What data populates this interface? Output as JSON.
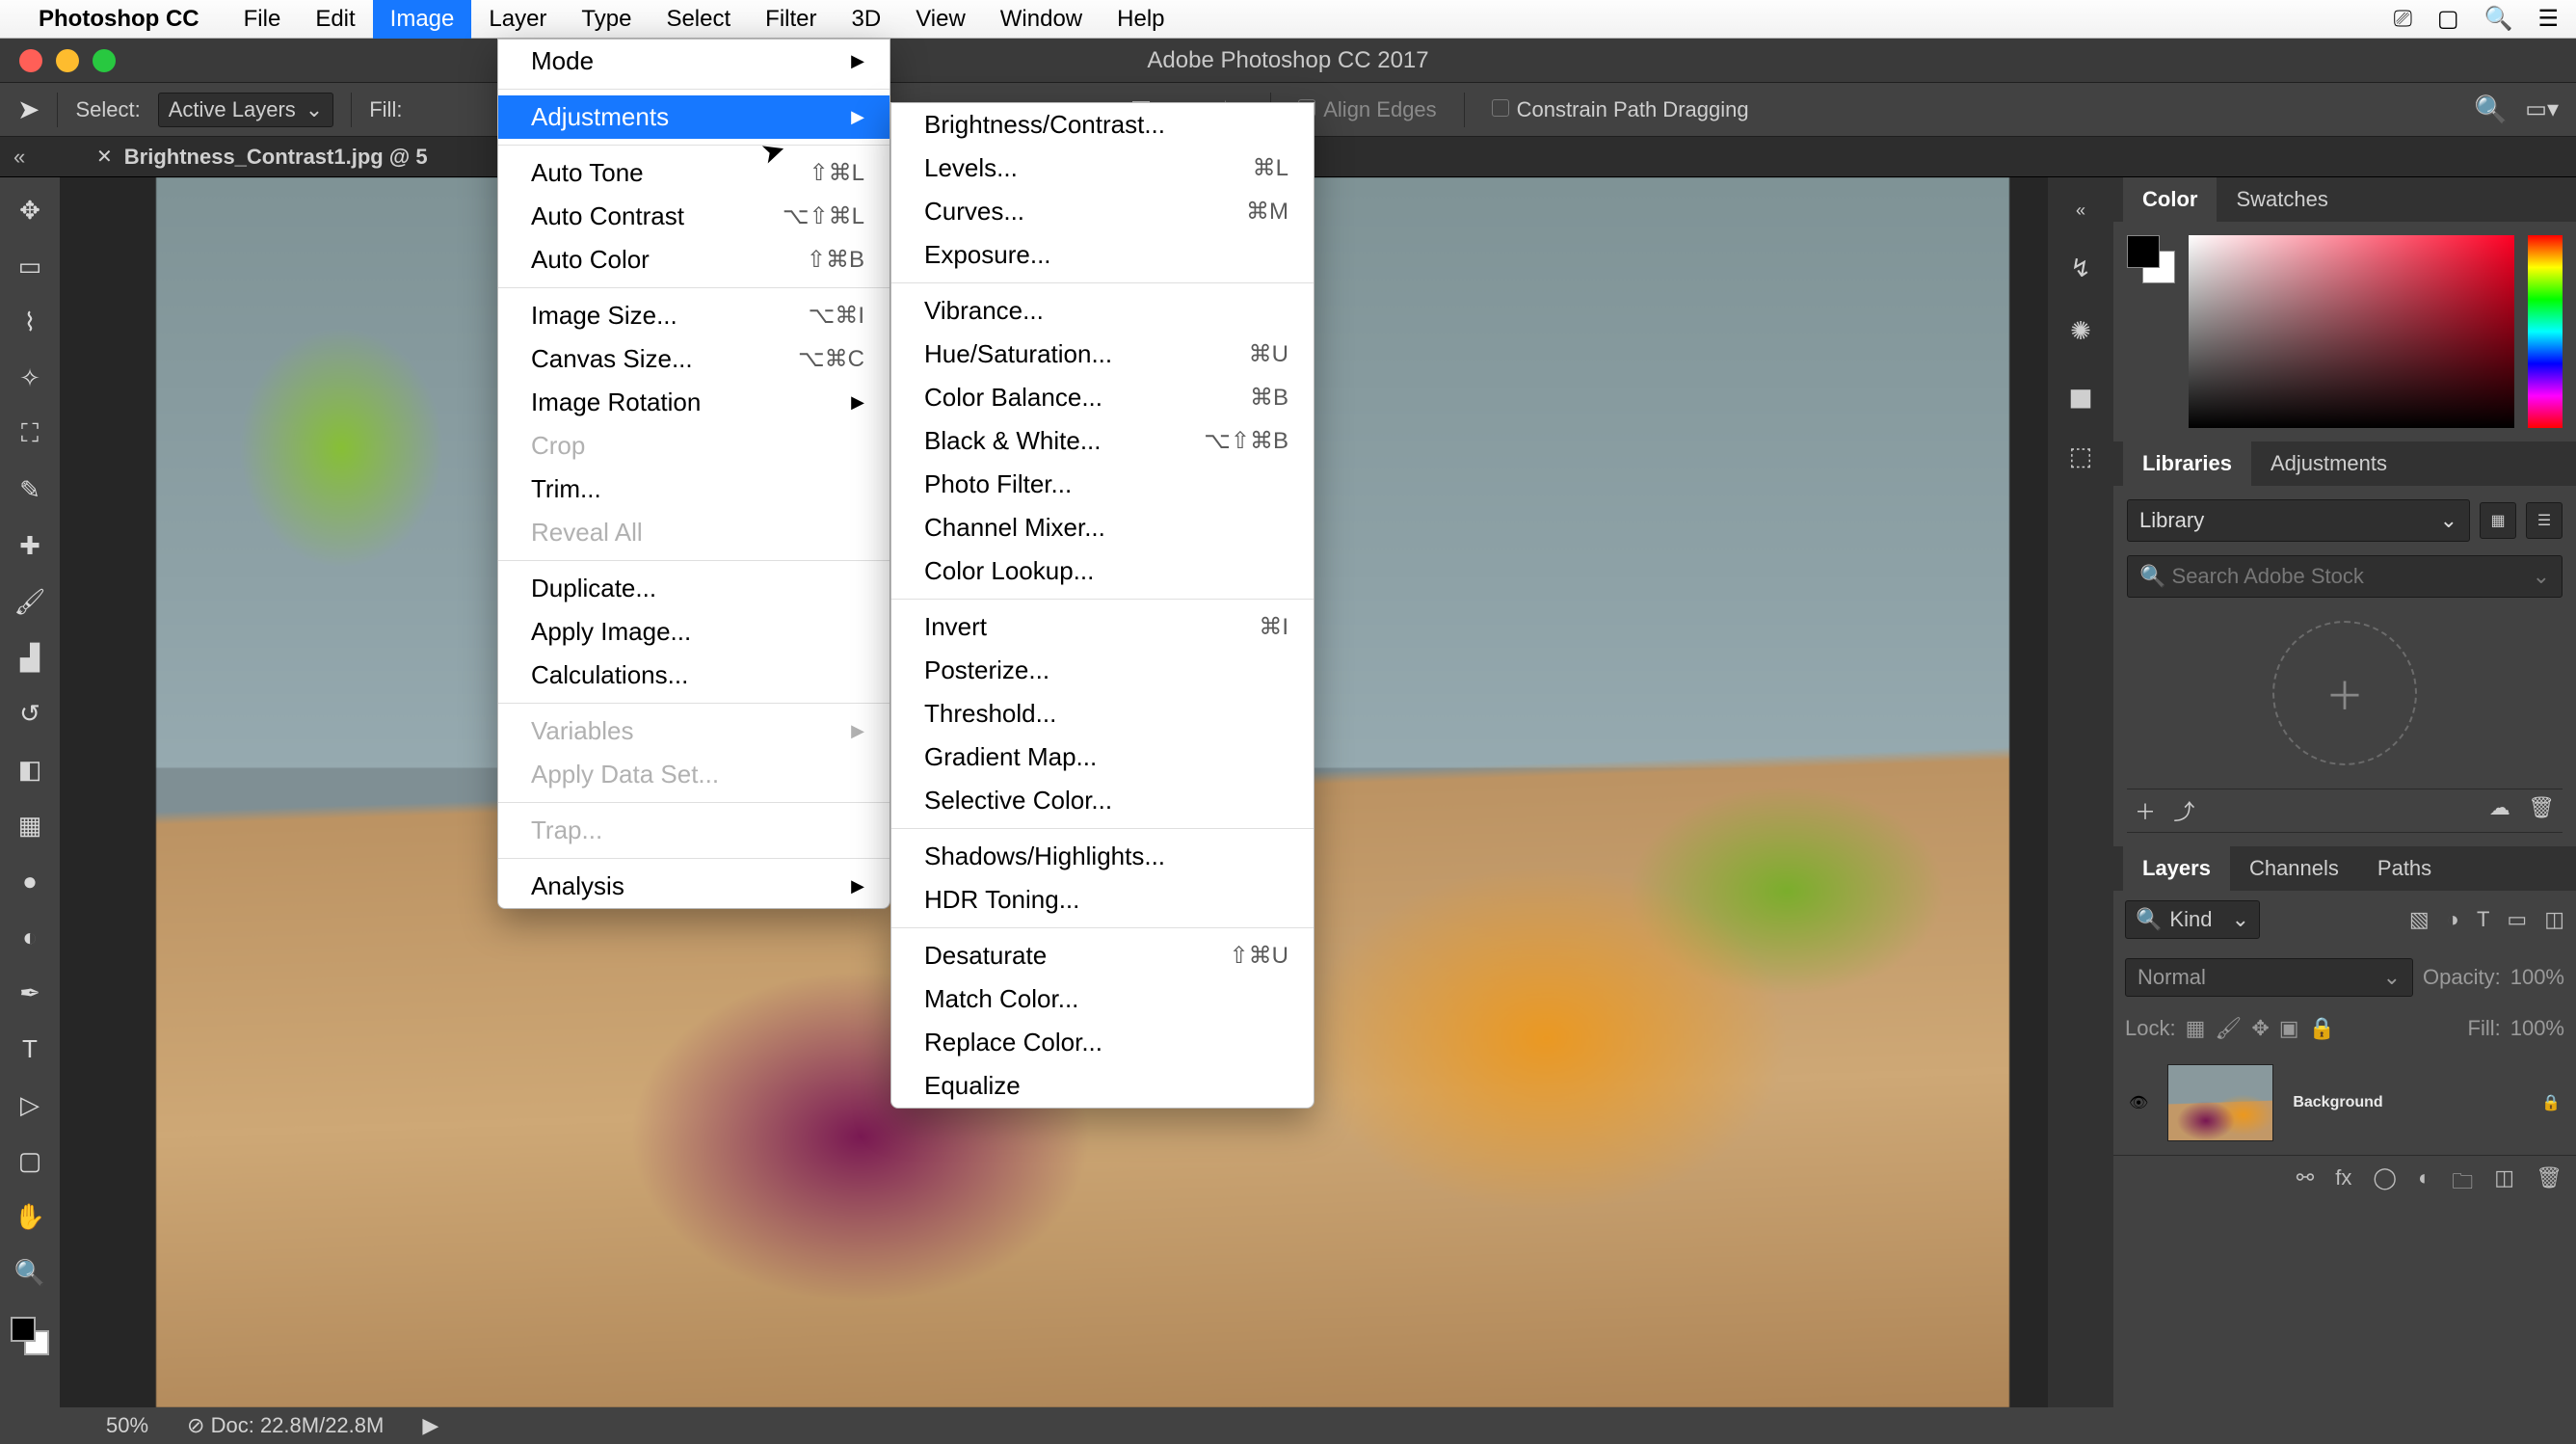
{
  "menubar": {
    "app_name": "Photoshop CC",
    "menus": [
      "File",
      "Edit",
      "Image",
      "Layer",
      "Type",
      "Select",
      "Filter",
      "3D",
      "View",
      "Window",
      "Help"
    ],
    "active": "Image"
  },
  "window": {
    "title": "Adobe Photoshop CC 2017"
  },
  "options_bar": {
    "select_label": "Select:",
    "select_value": "Active Layers",
    "fill_label": "Fill:",
    "align_edges": "Align Edges",
    "constrain": "Constrain Path Dragging"
  },
  "tab": {
    "filename": "Brightness_Contrast1.jpg @ 5"
  },
  "status": {
    "zoom": "50%",
    "doc": "Doc: 22.8M/22.8M"
  },
  "image_menu": {
    "groups": [
      [
        {
          "label": "Mode",
          "submenu": true
        }
      ],
      [
        {
          "label": "Adjustments",
          "submenu": true,
          "active": true
        }
      ],
      [
        {
          "label": "Auto Tone",
          "shortcut": "⇧⌘L"
        },
        {
          "label": "Auto Contrast",
          "shortcut": "⌥⇧⌘L"
        },
        {
          "label": "Auto Color",
          "shortcut": "⇧⌘B"
        }
      ],
      [
        {
          "label": "Image Size...",
          "shortcut": "⌥⌘I"
        },
        {
          "label": "Canvas Size...",
          "shortcut": "⌥⌘C"
        },
        {
          "label": "Image Rotation",
          "submenu": true
        },
        {
          "label": "Crop",
          "disabled": true
        },
        {
          "label": "Trim..."
        },
        {
          "label": "Reveal All",
          "disabled": true
        }
      ],
      [
        {
          "label": "Duplicate..."
        },
        {
          "label": "Apply Image..."
        },
        {
          "label": "Calculations..."
        }
      ],
      [
        {
          "label": "Variables",
          "submenu": true,
          "disabled": true
        },
        {
          "label": "Apply Data Set...",
          "disabled": true
        }
      ],
      [
        {
          "label": "Trap...",
          "disabled": true
        }
      ],
      [
        {
          "label": "Analysis",
          "submenu": true
        }
      ]
    ]
  },
  "adjustments_menu": {
    "groups": [
      [
        {
          "label": "Brightness/Contrast..."
        },
        {
          "label": "Levels...",
          "shortcut": "⌘L"
        },
        {
          "label": "Curves...",
          "shortcut": "⌘M"
        },
        {
          "label": "Exposure..."
        }
      ],
      [
        {
          "label": "Vibrance..."
        },
        {
          "label": "Hue/Saturation...",
          "shortcut": "⌘U"
        },
        {
          "label": "Color Balance...",
          "shortcut": "⌘B"
        },
        {
          "label": "Black & White...",
          "shortcut": "⌥⇧⌘B"
        },
        {
          "label": "Photo Filter..."
        },
        {
          "label": "Channel Mixer..."
        },
        {
          "label": "Color Lookup..."
        }
      ],
      [
        {
          "label": "Invert",
          "shortcut": "⌘I"
        },
        {
          "label": "Posterize..."
        },
        {
          "label": "Threshold..."
        },
        {
          "label": "Gradient Map..."
        },
        {
          "label": "Selective Color..."
        }
      ],
      [
        {
          "label": "Shadows/Highlights..."
        },
        {
          "label": "HDR Toning..."
        }
      ],
      [
        {
          "label": "Desaturate",
          "shortcut": "⇧⌘U"
        },
        {
          "label": "Match Color..."
        },
        {
          "label": "Replace Color..."
        },
        {
          "label": "Equalize"
        }
      ]
    ]
  },
  "panels": {
    "color_tabs": [
      "Color",
      "Swatches"
    ],
    "lib_tabs": [
      "Libraries",
      "Adjustments"
    ],
    "library_select": "Library",
    "lib_search_placeholder": "Search Adobe Stock",
    "layer_tabs": [
      "Layers",
      "Channels",
      "Paths"
    ],
    "kind": "Kind",
    "blend": "Normal",
    "opacity_label": "Opacity:",
    "opacity_value": "100%",
    "lock_label": "Lock:",
    "fill_label": "Fill:",
    "fill_value": "100%",
    "layer_name": "Background"
  },
  "tools": [
    "move",
    "marquee",
    "lasso",
    "wand",
    "crop",
    "eyedrop",
    "heal",
    "brush",
    "stamp",
    "history",
    "eraser",
    "gradient",
    "blur",
    "dodge",
    "pen",
    "type",
    "path",
    "shape",
    "hand",
    "zoom"
  ]
}
